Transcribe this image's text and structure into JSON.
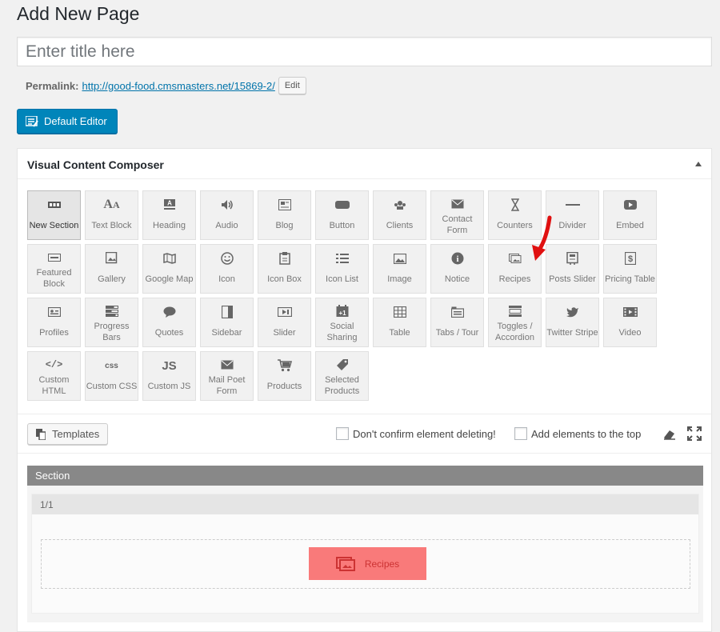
{
  "page": {
    "title": "Add New Page"
  },
  "title_input": {
    "placeholder": "Enter title here"
  },
  "permalink": {
    "label": "Permalink:",
    "url": "http://good-food.cmsmasters.net/15869-2/",
    "edit_label": "Edit"
  },
  "default_editor": {
    "label": "Default Editor"
  },
  "composer": {
    "title": "Visual Content Composer",
    "elements": [
      {
        "label": "New Section",
        "icon": "section-icon"
      },
      {
        "label": "Text Block",
        "icon": "text-icon"
      },
      {
        "label": "Heading",
        "icon": "heading-icon"
      },
      {
        "label": "Audio",
        "icon": "audio-icon"
      },
      {
        "label": "Blog",
        "icon": "blog-icon"
      },
      {
        "label": "Button",
        "icon": "button-icon"
      },
      {
        "label": "Clients",
        "icon": "clients-icon"
      },
      {
        "label": "Contact Form",
        "icon": "mail-icon"
      },
      {
        "label": "Counters",
        "icon": "hourglass-icon"
      },
      {
        "label": "Divider",
        "icon": "divider-icon"
      },
      {
        "label": "Embed",
        "icon": "play-icon"
      },
      {
        "label": "Featured Block",
        "icon": "featured-icon"
      },
      {
        "label": "Gallery",
        "icon": "gallery-icon"
      },
      {
        "label": "Google Map",
        "icon": "map-icon"
      },
      {
        "label": "Icon",
        "icon": "smiley-icon"
      },
      {
        "label": "Icon Box",
        "icon": "iconbox-icon"
      },
      {
        "label": "Icon List",
        "icon": "list-icon"
      },
      {
        "label": "Image",
        "icon": "image-icon"
      },
      {
        "label": "Notice",
        "icon": "info-icon"
      },
      {
        "label": "Recipes",
        "icon": "recipes-icon"
      },
      {
        "label": "Posts Slider",
        "icon": "posts-slider-icon"
      },
      {
        "label": "Pricing Table",
        "icon": "pricing-icon"
      },
      {
        "label": "Profiles",
        "icon": "profile-icon"
      },
      {
        "label": "Progress Bars",
        "icon": "progress-icon"
      },
      {
        "label": "Quotes",
        "icon": "quote-icon"
      },
      {
        "label": "Sidebar",
        "icon": "sidebar-icon"
      },
      {
        "label": "Slider",
        "icon": "slider-icon"
      },
      {
        "label": "Social Sharing",
        "icon": "share-icon"
      },
      {
        "label": "Table",
        "icon": "table-icon"
      },
      {
        "label": "Tabs / Tour",
        "icon": "tabs-icon"
      },
      {
        "label": "Toggles / Accordion",
        "icon": "toggles-icon"
      },
      {
        "label": "Twitter Stripe",
        "icon": "twitter-icon"
      },
      {
        "label": "Video",
        "icon": "video-icon"
      },
      {
        "label": "Custom HTML",
        "icon": "code-icon"
      },
      {
        "label": "Custom CSS",
        "icon": "css-icon"
      },
      {
        "label": "Custom JS",
        "icon": "js-icon"
      },
      {
        "label": "Mail Poet Form",
        "icon": "mail-icon"
      },
      {
        "label": "Products",
        "icon": "cart-icon"
      },
      {
        "label": "Selected Products",
        "icon": "tag-icon"
      }
    ],
    "icon_glyphs": {
      "text": "A",
      "heading": "A",
      "css": "css",
      "js": "JS",
      "code": "</>",
      "info": "i",
      "pricing": "$"
    }
  },
  "toolbar": {
    "templates_label": "Templates",
    "confirm_delete_label": "Don't confirm element deleting!",
    "add_top_label": "Add elements to the top"
  },
  "builder": {
    "section_label": "Section",
    "column_label": "1/1",
    "block_label": "Recipes"
  },
  "colors": {
    "primary": "#0085ba",
    "recipe_block": "#f97a7a",
    "arrow": "#e01010"
  }
}
